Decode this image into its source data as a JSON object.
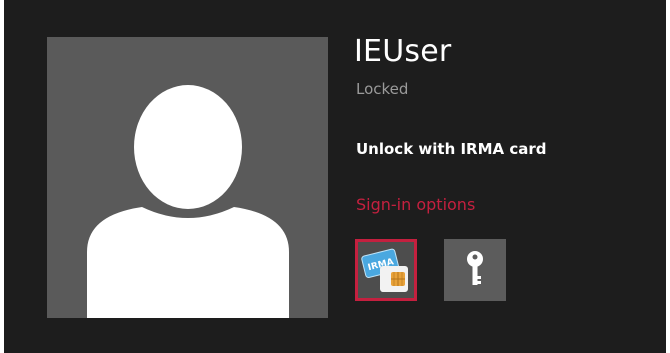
{
  "user": {
    "name": "IEUser",
    "status": "Locked"
  },
  "prompt": "Unlock with IRMA card",
  "sign_in_options_label": "Sign-in options",
  "providers": [
    {
      "id": "irma-card",
      "icon": "irma-card-icon",
      "card_text": "IRMA",
      "selected": true
    },
    {
      "id": "password",
      "icon": "key-icon",
      "selected": false
    }
  ],
  "colors": {
    "background": "#1d1d1d",
    "accent": "#c4203f",
    "avatar_bg": "#5a5a5a",
    "tile_bg": "#5c5c5c",
    "text_primary": "#ffffff",
    "text_secondary": "#9a9a9a"
  }
}
